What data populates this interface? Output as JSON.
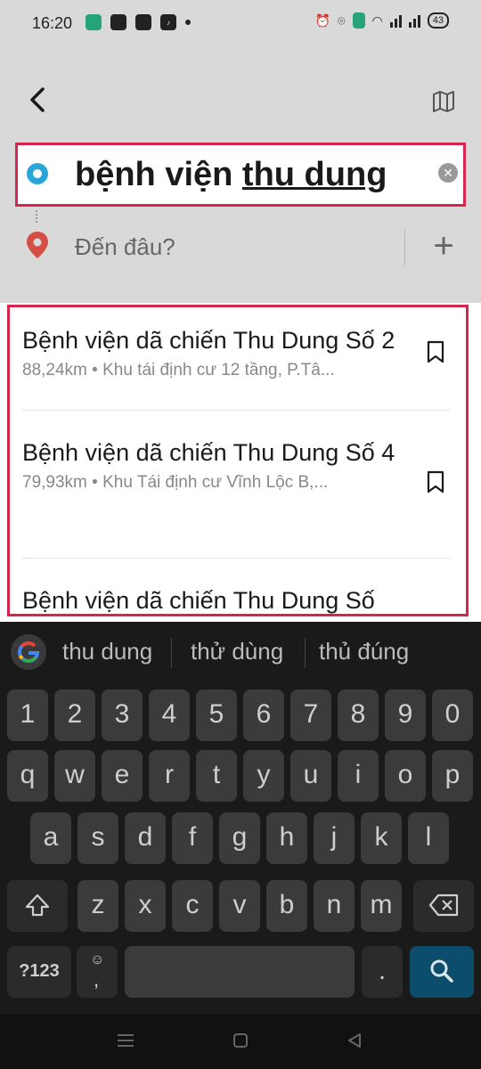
{
  "status_bar": {
    "time": "16:20",
    "battery": "43"
  },
  "search": {
    "query_part1": "bệnh viện ",
    "query_part2": "thu dung",
    "destination_placeholder": "Đến đâu?"
  },
  "results": [
    {
      "title": "Bệnh viện dã chiến Thu Dung Số 2",
      "distance": "88,24km",
      "address": "Khu tái định cư 12 tầng, P.Tâ..."
    },
    {
      "title": "Bệnh viện dã chiến Thu Dung Số 4",
      "distance": "79,93km",
      "address": "Khu Tái định cư Vĩnh Lộc B,..."
    },
    {
      "title": "Bệnh viện dã chiến Thu Dung Số",
      "distance": "",
      "address": ""
    }
  ],
  "separator": "•",
  "keyboard": {
    "suggestions": [
      "thu dung",
      "thử dùng",
      "thủ đúng"
    ],
    "row_numbers": [
      "1",
      "2",
      "3",
      "4",
      "5",
      "6",
      "7",
      "8",
      "9",
      "0"
    ],
    "row1": [
      "q",
      "w",
      "e",
      "r",
      "t",
      "y",
      "u",
      "i",
      "o",
      "p"
    ],
    "row2": [
      "a",
      "s",
      "d",
      "f",
      "g",
      "h",
      "j",
      "k",
      "l"
    ],
    "row3": [
      "z",
      "x",
      "c",
      "v",
      "b",
      "n",
      "m"
    ],
    "symbols_label": "?123",
    "comma": ",",
    "period": "."
  },
  "colors": {
    "highlight": "#d8254d",
    "origin_dot": "#2aa6d6",
    "pin": "#d44f45",
    "search_key": "#0b4d6b"
  }
}
